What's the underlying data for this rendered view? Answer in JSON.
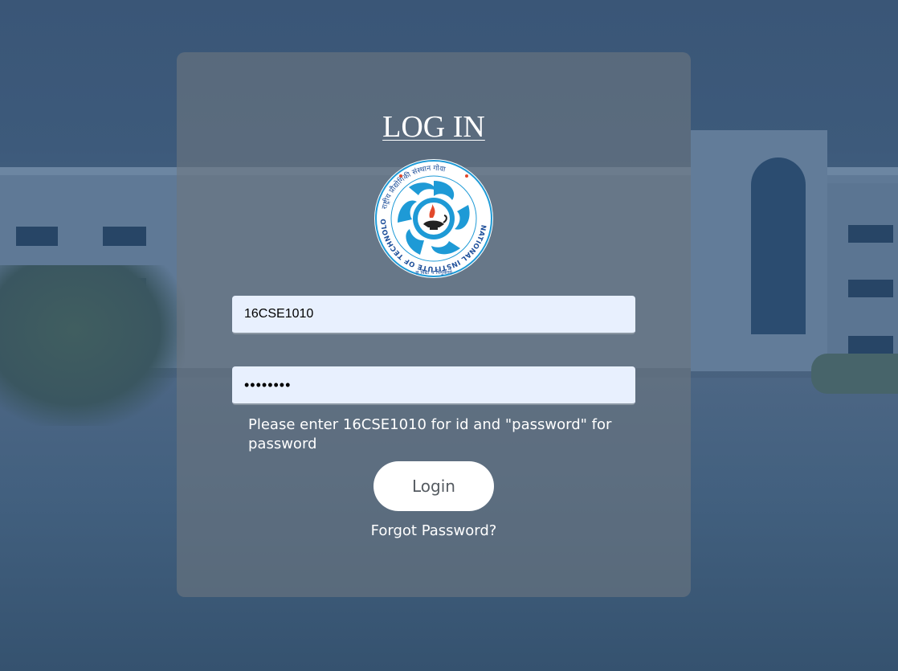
{
  "page": {
    "title": "LOG IN"
  },
  "logo": {
    "icon": "institute-emblem-icon",
    "ring_text": "NATIONAL INSTITUTE OF TECHNOLOGY GOA",
    "hindi_ring_text": "राष्ट्रीय प्रौद्योगिकी संस्थान गोवा",
    "motto": "ज्ञ विद्या च विमुक्तये"
  },
  "form": {
    "username_value": "16CSE1010",
    "password_value": "password",
    "hint": "Please enter 16CSE1010 for id and \"password\" for password",
    "login_label": "Login",
    "forgot_label": "Forgot Password?"
  },
  "colors": {
    "background": "#2f4a6b",
    "card": "rgba(108,118,128,0.62)",
    "input_bg": "#e8f0fe",
    "emblem_blue": "#1e9ad6"
  }
}
